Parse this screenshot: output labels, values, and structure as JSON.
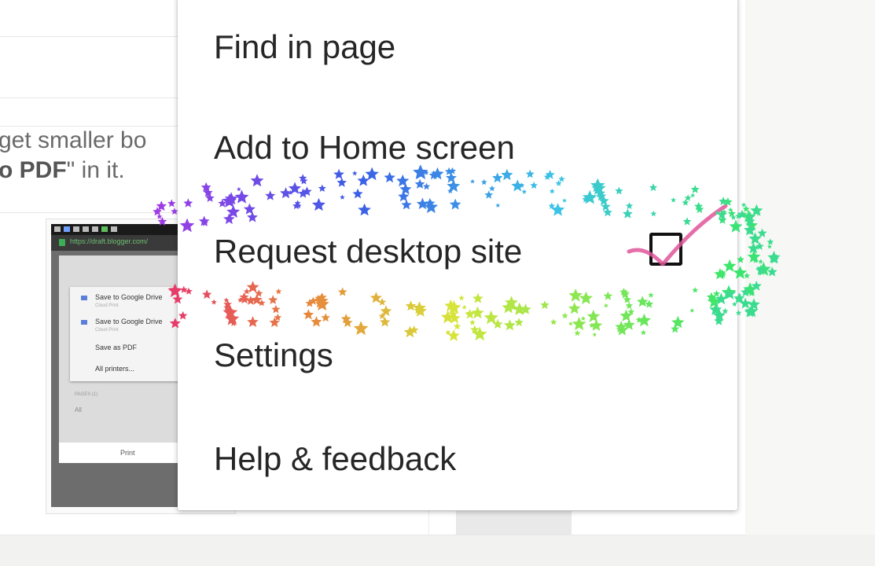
{
  "background_page": {
    "text_line_1": "get smaller bo",
    "text_line_2_bold": "o PDF",
    "text_line_2_rest": "\" in it."
  },
  "embedded_screenshot": {
    "url": "https://draft.blogger.com/",
    "dialog_items": [
      {
        "label": "Save to Google Drive",
        "sub": "Cloud Print"
      },
      {
        "label": "Save to Google Drive",
        "sub": "Cloud Print"
      },
      {
        "label": "Save as PDF",
        "sub": ""
      },
      {
        "label": "All printers...",
        "sub": ""
      }
    ],
    "pages_label": "PAGES (1)",
    "pages_value": "All",
    "print_button": "Print"
  },
  "menu": {
    "items": [
      {
        "label": "Find in page",
        "icon": ""
      },
      {
        "label": "Add to Home screen",
        "icon": ""
      },
      {
        "label": "Request desktop site",
        "icon": "checkbox-icon",
        "checked": false
      },
      {
        "label": "Settings",
        "icon": ""
      },
      {
        "label": "Help & feedback",
        "icon": ""
      }
    ]
  },
  "decoration": {
    "sparkle_colors": [
      "#a03be6",
      "#3b5ee6",
      "#3bc3e6",
      "#3be66a",
      "#d6e63b",
      "#e68a3b",
      "#e63b6a"
    ],
    "checkmark_color": "#e0559a"
  }
}
